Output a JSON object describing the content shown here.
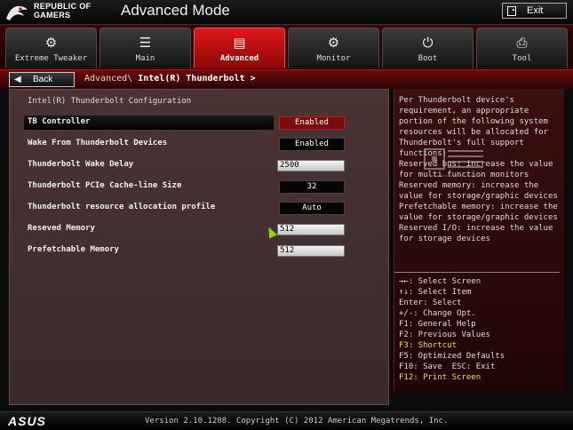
{
  "header": {
    "brand_line1": "REPUBLIC OF",
    "brand_line2": "GAMERS",
    "title": "Advanced Mode",
    "exit_label": "Exit"
  },
  "tabs": [
    {
      "label": "Extreme Tweaker",
      "icon": "tweaker-icon",
      "glyph": "⚙"
    },
    {
      "label": "Main",
      "icon": "list-icon",
      "glyph": "☰"
    },
    {
      "label": "Advanced",
      "icon": "advanced-icon",
      "glyph": "▤",
      "active": true
    },
    {
      "label": "Monitor",
      "icon": "monitor-icon",
      "glyph": "⚙"
    },
    {
      "label": "Boot",
      "icon": "power-icon",
      "glyph": "⏻"
    },
    {
      "label": "Tool",
      "icon": "printer-icon",
      "glyph": "⎙"
    }
  ],
  "breadcrumb": {
    "back_label": "Back",
    "parent": "Advanced\\",
    "current": "Intel(R) Thunderbolt >"
  },
  "main": {
    "section_title": "Intel(R) Thunderbolt Configuration",
    "settings": [
      {
        "label": "TB Controller",
        "value": "Enabled",
        "type": "select",
        "selected": true
      },
      {
        "label": "Wake From Thunderbolt Devices",
        "value": "Enabled",
        "type": "select"
      },
      {
        "label": "Thunderbolt Wake Delay",
        "value": "2500",
        "type": "number"
      },
      {
        "label": "Thunderbolt PCIe Cache-line Size",
        "value": "32",
        "type": "select"
      },
      {
        "label": "Thunderbolt resource allocation profile",
        "value": "Auto",
        "type": "select"
      },
      {
        "label": "Reseved Memory",
        "value": "512",
        "type": "number"
      },
      {
        "label": "Prefetchable Memory",
        "value": "512",
        "type": "number"
      }
    ]
  },
  "help": {
    "description": "Per Thunderbolt device's requirement, an appropriate portion of the following system resources will be allocated for Thunderbolt's full support functions:\nReserved bus: increase the value for multi function monitors\nReserved memory: increase the value for storage/graphic devices\nPrefetchable memory: increase the value for storage/graphic devices\nReserved I/O: increase the value for storage devices",
    "keys": [
      {
        "text": "→←: Select Screen",
        "highlight": false
      },
      {
        "text": "↑↓: Select Item",
        "highlight": false
      },
      {
        "text": "Enter: Select",
        "highlight": false
      },
      {
        "text": "+/-: Change Opt.",
        "highlight": false
      },
      {
        "text": "F1: General Help",
        "highlight": false
      },
      {
        "text": "F2: Previous Values",
        "highlight": false
      },
      {
        "text": "F3: Shortcut",
        "highlight": true
      },
      {
        "text": "F5: Optimized Defaults",
        "highlight": false
      },
      {
        "text": "F10: Save  ESC: Exit",
        "highlight": false
      },
      {
        "text": "F12: Print Screen",
        "highlight": true
      }
    ],
    "highlight_color": "#f5e020"
  },
  "footer": {
    "logo": "ASUS",
    "version": "Version 2.10.1208. Copyright (C) 2012 American Megatrends, Inc."
  },
  "colors": {
    "accent": "#e01818",
    "selected_value_bg": "#7a0c0c",
    "panel_bg": "#3a2a2a"
  }
}
